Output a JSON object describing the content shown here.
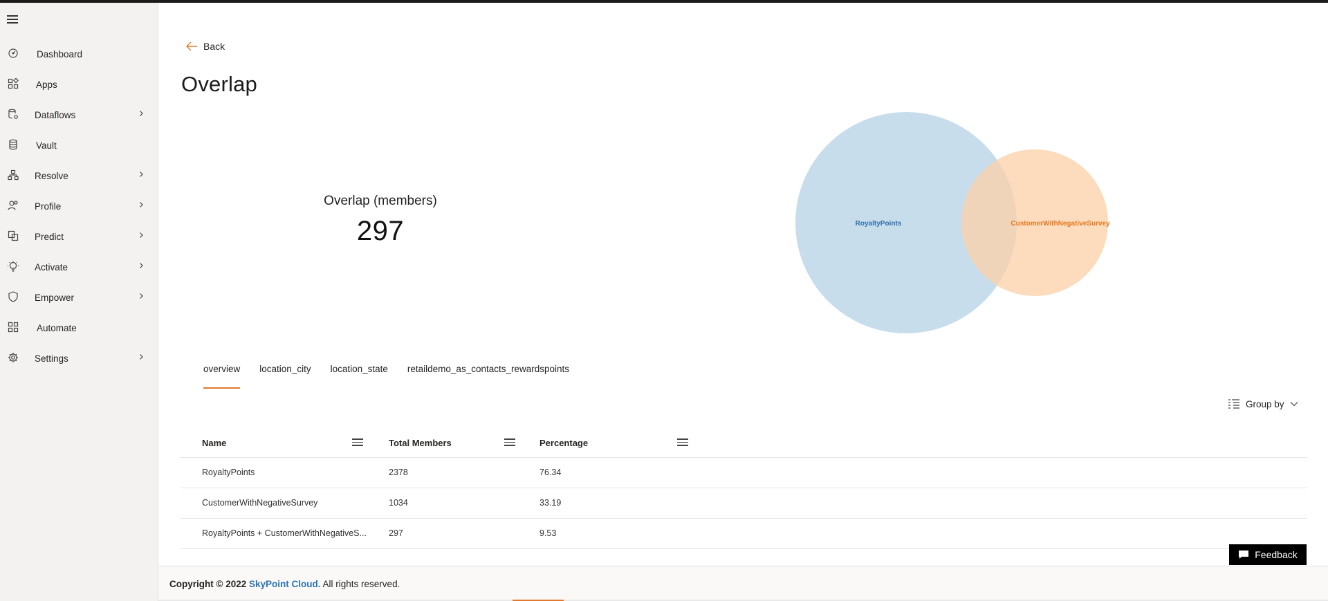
{
  "sidebar": {
    "items": [
      {
        "label": "Dashboard",
        "icon": "gauge-icon",
        "expandable": false
      },
      {
        "label": "Apps",
        "icon": "apps-grid-icon",
        "expandable": false
      },
      {
        "label": "Dataflows",
        "icon": "database-gear-icon",
        "expandable": true
      },
      {
        "label": "Vault",
        "icon": "database-icon",
        "expandable": false
      },
      {
        "label": "Resolve",
        "icon": "hierarchy-icon",
        "expandable": true
      },
      {
        "label": "Profile",
        "icon": "people-icon",
        "expandable": true
      },
      {
        "label": "Predict",
        "icon": "documents-icon",
        "expandable": true
      },
      {
        "label": "Activate",
        "icon": "lightbulb-icon",
        "expandable": true
      },
      {
        "label": "Empower",
        "icon": "shield-icon",
        "expandable": true
      },
      {
        "label": "Automate",
        "icon": "apps-grid-icon",
        "expandable": false
      },
      {
        "label": "Settings",
        "icon": "gear-icon",
        "expandable": true
      }
    ]
  },
  "header": {
    "back_label": "Back",
    "title": "Overlap"
  },
  "kpi": {
    "label": "Overlap (members)",
    "value": "297"
  },
  "venn": {
    "set_a": {
      "label": "RoyaltyPoints",
      "color": "#b4d1e6",
      "text_color": "#2e6ea8"
    },
    "set_b": {
      "label": "CustomerWithNegativeSurvey",
      "color": "#fcd0a8",
      "text_color": "#e4781f"
    }
  },
  "tabs": [
    {
      "label": "overview",
      "active": true
    },
    {
      "label": "location_city",
      "active": false
    },
    {
      "label": "location_state",
      "active": false
    },
    {
      "label": "retaildemo_as_contacts_rewardspoints",
      "active": false
    }
  ],
  "toolbar": {
    "group_by_label": "Group by"
  },
  "table": {
    "columns": [
      "Name",
      "Total Members",
      "Percentage"
    ],
    "rows": [
      [
        "RoyaltyPoints",
        "2378",
        "76.34"
      ],
      [
        "CustomerWithNegativeSurvey",
        "1034",
        "33.19"
      ],
      [
        "RoyaltyPoints + CustomerWithNegativeS...",
        "297",
        "9.53"
      ]
    ]
  },
  "feedback_label": "Feedback",
  "footer": {
    "prefix": "Copyright © 2022",
    "brand": "SkyPoint Cloud.",
    "suffix": "All rights reserved."
  },
  "colors": {
    "accent": "#e17a30",
    "brand_link": "#2c73b5"
  }
}
